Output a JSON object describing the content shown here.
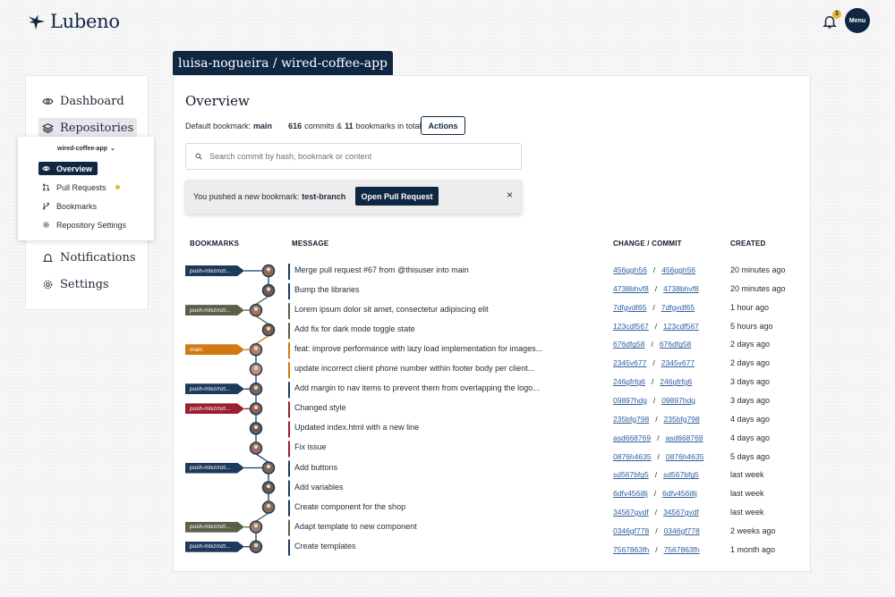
{
  "header": {
    "logo_text": "Lubeno",
    "notification_count": "3",
    "menu_label": "Menu"
  },
  "sidebar": {
    "items": [
      {
        "label": "Dashboard",
        "icon": "eye-icon"
      },
      {
        "label": "Repositories",
        "icon": "layers-icon"
      },
      {
        "label": "Notifications",
        "icon": "bell-icon"
      },
      {
        "label": "Settings",
        "icon": "gear-icon"
      }
    ],
    "repo_select": "wired-coffee-app",
    "sub_items": [
      {
        "label": "Overview",
        "icon": "eye-icon"
      },
      {
        "label": "Pull Requests",
        "icon": "pull-request-icon"
      },
      {
        "label": "Bookmarks",
        "icon": "branch-icon"
      },
      {
        "label": "Repository Settings",
        "icon": "gear-icon"
      }
    ]
  },
  "repo_title": "luisa-nogueira / wired-coffee-app",
  "overview": {
    "title": "Overview",
    "default_bookmark_label": "Default bookmark:",
    "default_bookmark": "main",
    "commits_count": "616",
    "commits_label": "commits &",
    "bookmarks_count": "11",
    "bookmarks_label": "bookmarks in total",
    "actions_label": "Actions",
    "search_placeholder": "Search commit by hash, bookmark or content",
    "alert_text": "You pushed a new bookmark:",
    "alert_bookmark": "test-branch",
    "alert_button": "Open Pull Request",
    "alert_close": "×"
  },
  "table": {
    "headers": [
      "BOOKMARKS",
      "MESSAGE",
      "CHANGE / COMMIT",
      "CREATED"
    ],
    "rows": [
      {
        "bookmark": "push-mlxzmzt...",
        "bookmark_color": "#1d3a5c",
        "message": "Merge pull request #67 from @thisuser into main",
        "change": "456ggh56",
        "commit": "456ggh56",
        "created": "20 minutes ago"
      },
      {
        "bookmark": "",
        "message": "Bump the libraries",
        "change": "4738bhvf8",
        "commit": "4738bhvf8",
        "created": "20 minutes ago"
      },
      {
        "bookmark": "push-mlxzmzt...",
        "bookmark_color": "#5c5f4a",
        "message": "Lorem ipsum dolor sit amet, consectetur adipiscing elit",
        "change": "7dfgvdf65",
        "commit": "7dfgvdf65",
        "created": "1 hour ago"
      },
      {
        "bookmark": "",
        "message": "Add fix for dark mode toggle state",
        "change": "123cdf567",
        "commit": "123cdf567",
        "created": "5 hours ago"
      },
      {
        "bookmark": "main",
        "bookmark_color": "#d07a12",
        "message": "feat: improve performance with lazy load implementation for images...",
        "change": "676dfg58",
        "commit": "676dfg58",
        "created": "2 days ago"
      },
      {
        "bookmark": "",
        "message": "update incorrect client phone number within footer body per client...",
        "change": "2345v677",
        "commit": "2345v677",
        "created": "2 days ago"
      },
      {
        "bookmark": "push-mlxzmzt...",
        "bookmark_color": "#1d3a5c",
        "message": "Add margin to nav items to prevent them from overlapping the logo...",
        "change": "246gfrfg6",
        "commit": "246gfrfg6",
        "created": "3 days ago"
      },
      {
        "bookmark": "push-mlxzmzt...",
        "bookmark_color": "#9b1f2e",
        "message": "Changed style",
        "change": "09897hdg",
        "commit": "09897hdg",
        "created": "3 days ago"
      },
      {
        "bookmark": "",
        "message": "Updated index.html with a new line",
        "change": "235bfg798",
        "commit": "235bfg798",
        "created": "4 days ago"
      },
      {
        "bookmark": "",
        "message": "Fix issue",
        "change": "asd668769",
        "commit": "asd668769",
        "created": "4 days ago"
      },
      {
        "bookmark": "push-mlxzmzt...",
        "bookmark_color": "#1d3a5c",
        "message": "Add buttons",
        "change": "0876h4635",
        "commit": "0876h4635",
        "created": "5 days ago"
      },
      {
        "bookmark": "",
        "message": "Add variables",
        "change": "sd567bfg5",
        "commit": "sd567bfg5",
        "created": "last week"
      },
      {
        "bookmark": "",
        "message": "Create component for the shop",
        "change": "6dfv456i8j",
        "commit": "6dfv456i8j",
        "created": "last week"
      },
      {
        "bookmark": "push-mlxzmzt...",
        "bookmark_color": "#5c5f4a",
        "message": "Adapt template to new component",
        "change": "34567gvdf",
        "commit": "34567gvdf",
        "created": "last week"
      },
      {
        "bookmark": "push-mlxzmzt...",
        "bookmark_color": "#1d3a5c",
        "message": "Create templates",
        "change": "0346gf778",
        "commit": "0346gf778",
        "created": "2 weeks ago"
      },
      {
        "bookmark": "",
        "message": "",
        "change": "7567863fh",
        "commit": "7567863fh",
        "created": "1 month ago"
      }
    ]
  },
  "colors": {
    "navy": "#0f2742",
    "link": "#2f5f9e",
    "accent_yellow": "#e2b93b",
    "lane_orange": "#d07a12",
    "lane_red": "#9b1f2e",
    "lane_olive": "#5c5f4a"
  }
}
